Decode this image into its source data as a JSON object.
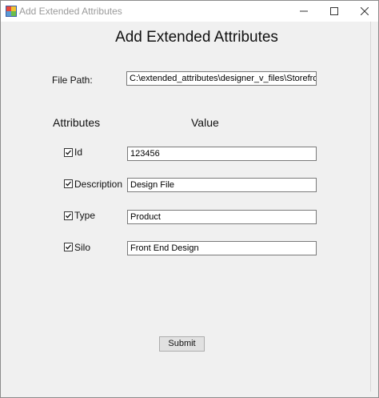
{
  "window": {
    "title": "Add Extended Attributes",
    "app_icon": "windows-forms-app-icon"
  },
  "form": {
    "heading": "Add Extended Attributes",
    "file_path_label": "File Path:",
    "file_path_value": "C:\\extended_attributes\\designer_v_files\\Storefront",
    "attributes_header": "Attributes",
    "value_header": "Value",
    "attributes": [
      {
        "label": "Id",
        "checked": true,
        "value": "123456"
      },
      {
        "label": "Description",
        "checked": true,
        "value": "Design File"
      },
      {
        "label": "Type",
        "checked": true,
        "value": "Product"
      },
      {
        "label": "Silo",
        "checked": true,
        "value": "Front End Design"
      }
    ],
    "submit_label": "Submit"
  }
}
